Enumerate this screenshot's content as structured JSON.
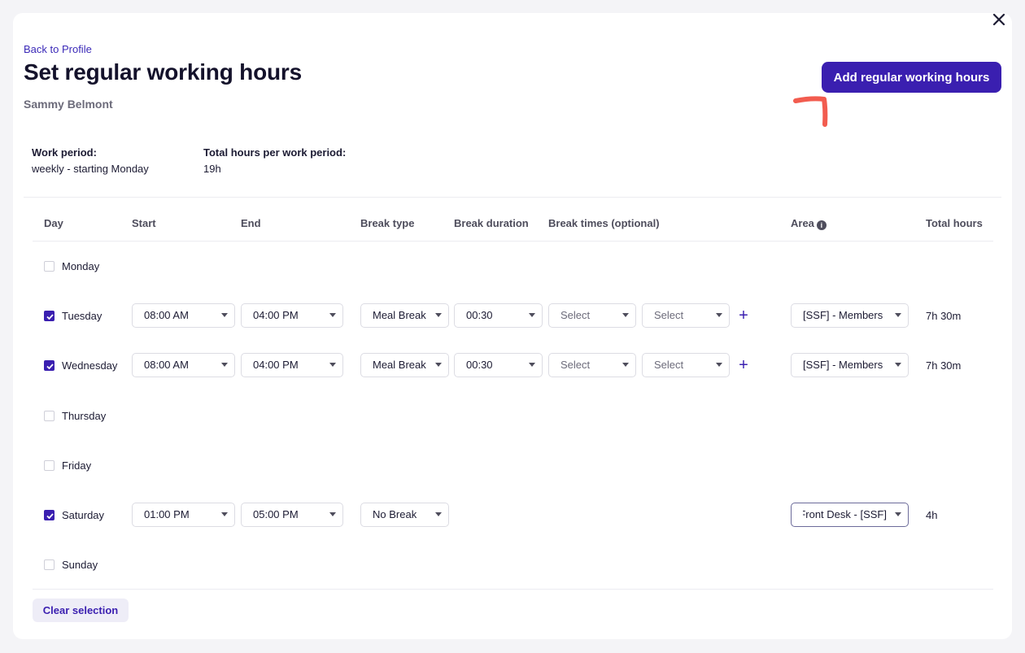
{
  "header": {
    "back_link": "Back to Profile",
    "title": "Set regular working hours",
    "employee_name": "Sammy Belmont",
    "add_button": "Add regular working hours"
  },
  "summary": {
    "work_period_label": "Work period:",
    "work_period_value": "weekly - starting Monday",
    "total_hours_label": "Total hours per work period:",
    "total_hours_value": "19h"
  },
  "columns": {
    "day": "Day",
    "start": "Start",
    "end": "End",
    "break_type": "Break type",
    "break_duration": "Break duration",
    "break_times": "Break times (optional)",
    "area": "Area",
    "total_hours": "Total hours"
  },
  "days": [
    {
      "name": "Monday",
      "checked": false
    },
    {
      "name": "Tuesday",
      "checked": true,
      "start": "08:00 AM",
      "end": "04:00 PM",
      "break_type": "Meal Break",
      "break_duration": "00:30",
      "break_from": "Select",
      "break_to": "Select",
      "area": "[SSF] - Members",
      "total": "7h 30m"
    },
    {
      "name": "Wednesday",
      "checked": true,
      "start": "08:00 AM",
      "end": "04:00 PM",
      "break_type": "Meal Break",
      "break_duration": "00:30",
      "break_from": "Select",
      "break_to": "Select",
      "area": "[SSF] - Members",
      "total": "7h 30m"
    },
    {
      "name": "Thursday",
      "checked": false
    },
    {
      "name": "Friday",
      "checked": false
    },
    {
      "name": "Saturday",
      "checked": true,
      "start": "01:00 PM",
      "end": "05:00 PM",
      "break_type": "No Break",
      "area": "[SSF] - Front Desk",
      "total": "4h"
    },
    {
      "name": "Sunday",
      "checked": false
    }
  ],
  "footer": {
    "clear_button": "Clear selection"
  },
  "colors": {
    "primary": "#3a1fb0",
    "annotation": "#f25c4f",
    "page_bg": "#f4f4f7"
  },
  "icons": {
    "close": "close-icon",
    "info": "info-icon",
    "caret": "chevron-down-icon",
    "add": "plus-icon",
    "check": "check-icon"
  }
}
